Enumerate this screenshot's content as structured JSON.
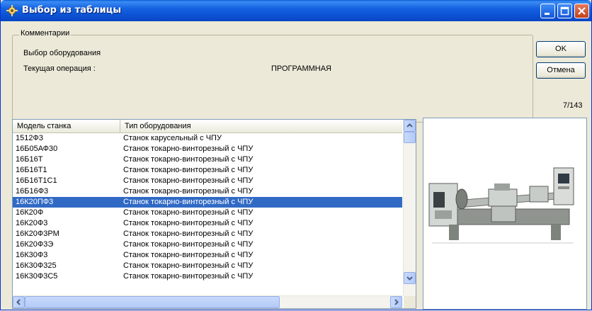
{
  "window": {
    "title": "Выбор из таблицы",
    "icon": "app-icon",
    "controls": [
      "minimize-icon",
      "maximize-icon",
      "close-icon"
    ]
  },
  "comments": {
    "group_title": "Комментарии",
    "line1": "Выбор оборудования",
    "operation_label": "Текущая операция :",
    "operation_value": "ПРОГРАММНАЯ"
  },
  "buttons": {
    "ok": "OK",
    "cancel": "Отмена"
  },
  "counter": "7/143",
  "table": {
    "columns": [
      "Модель станка",
      "Тип оборудования"
    ],
    "selected_index": 6,
    "rows": [
      [
        "1512Ф3",
        "Станок карусельный с ЧПУ"
      ],
      [
        "16Б05АФ30",
        "Станок токарно-винторезный с ЧПУ"
      ],
      [
        "16Б16Т",
        "Станок токарно-винторезный с ЧПУ"
      ],
      [
        "16Б16Т1",
        "Станок токарно-винторезный с ЧПУ"
      ],
      [
        "16Б16Т1С1",
        "Станок токарно-винторезный с ЧПУ"
      ],
      [
        "16Б16Ф3",
        "Станок токарно-винторезный с ЧПУ"
      ],
      [
        "16К20ПФ3",
        "Станок токарно-винторезный с ЧПУ"
      ],
      [
        "16К20Ф",
        "Станок токарно-винторезный с ЧПУ"
      ],
      [
        "16К20Ф3",
        "Станок токарно-винторезный с ЧПУ"
      ],
      [
        "16К20Ф3РМ",
        "Станок токарно-винторезный с ЧПУ"
      ],
      [
        "16К20Ф3Э",
        "Станок токарно-винторезный с ЧПУ"
      ],
      [
        "16К30Ф3",
        "Станок токарно-винторезный с ЧПУ"
      ],
      [
        "16К30Ф325",
        "Станок токарно-винторезный с ЧПУ"
      ],
      [
        "16К30Ф3С5",
        "Станок токарно-винторезный с ЧПУ"
      ]
    ]
  },
  "colors": {
    "titlebar": "#0a4fd0",
    "selection": "#316ac5",
    "dialog_bg": "#ece9d8"
  }
}
